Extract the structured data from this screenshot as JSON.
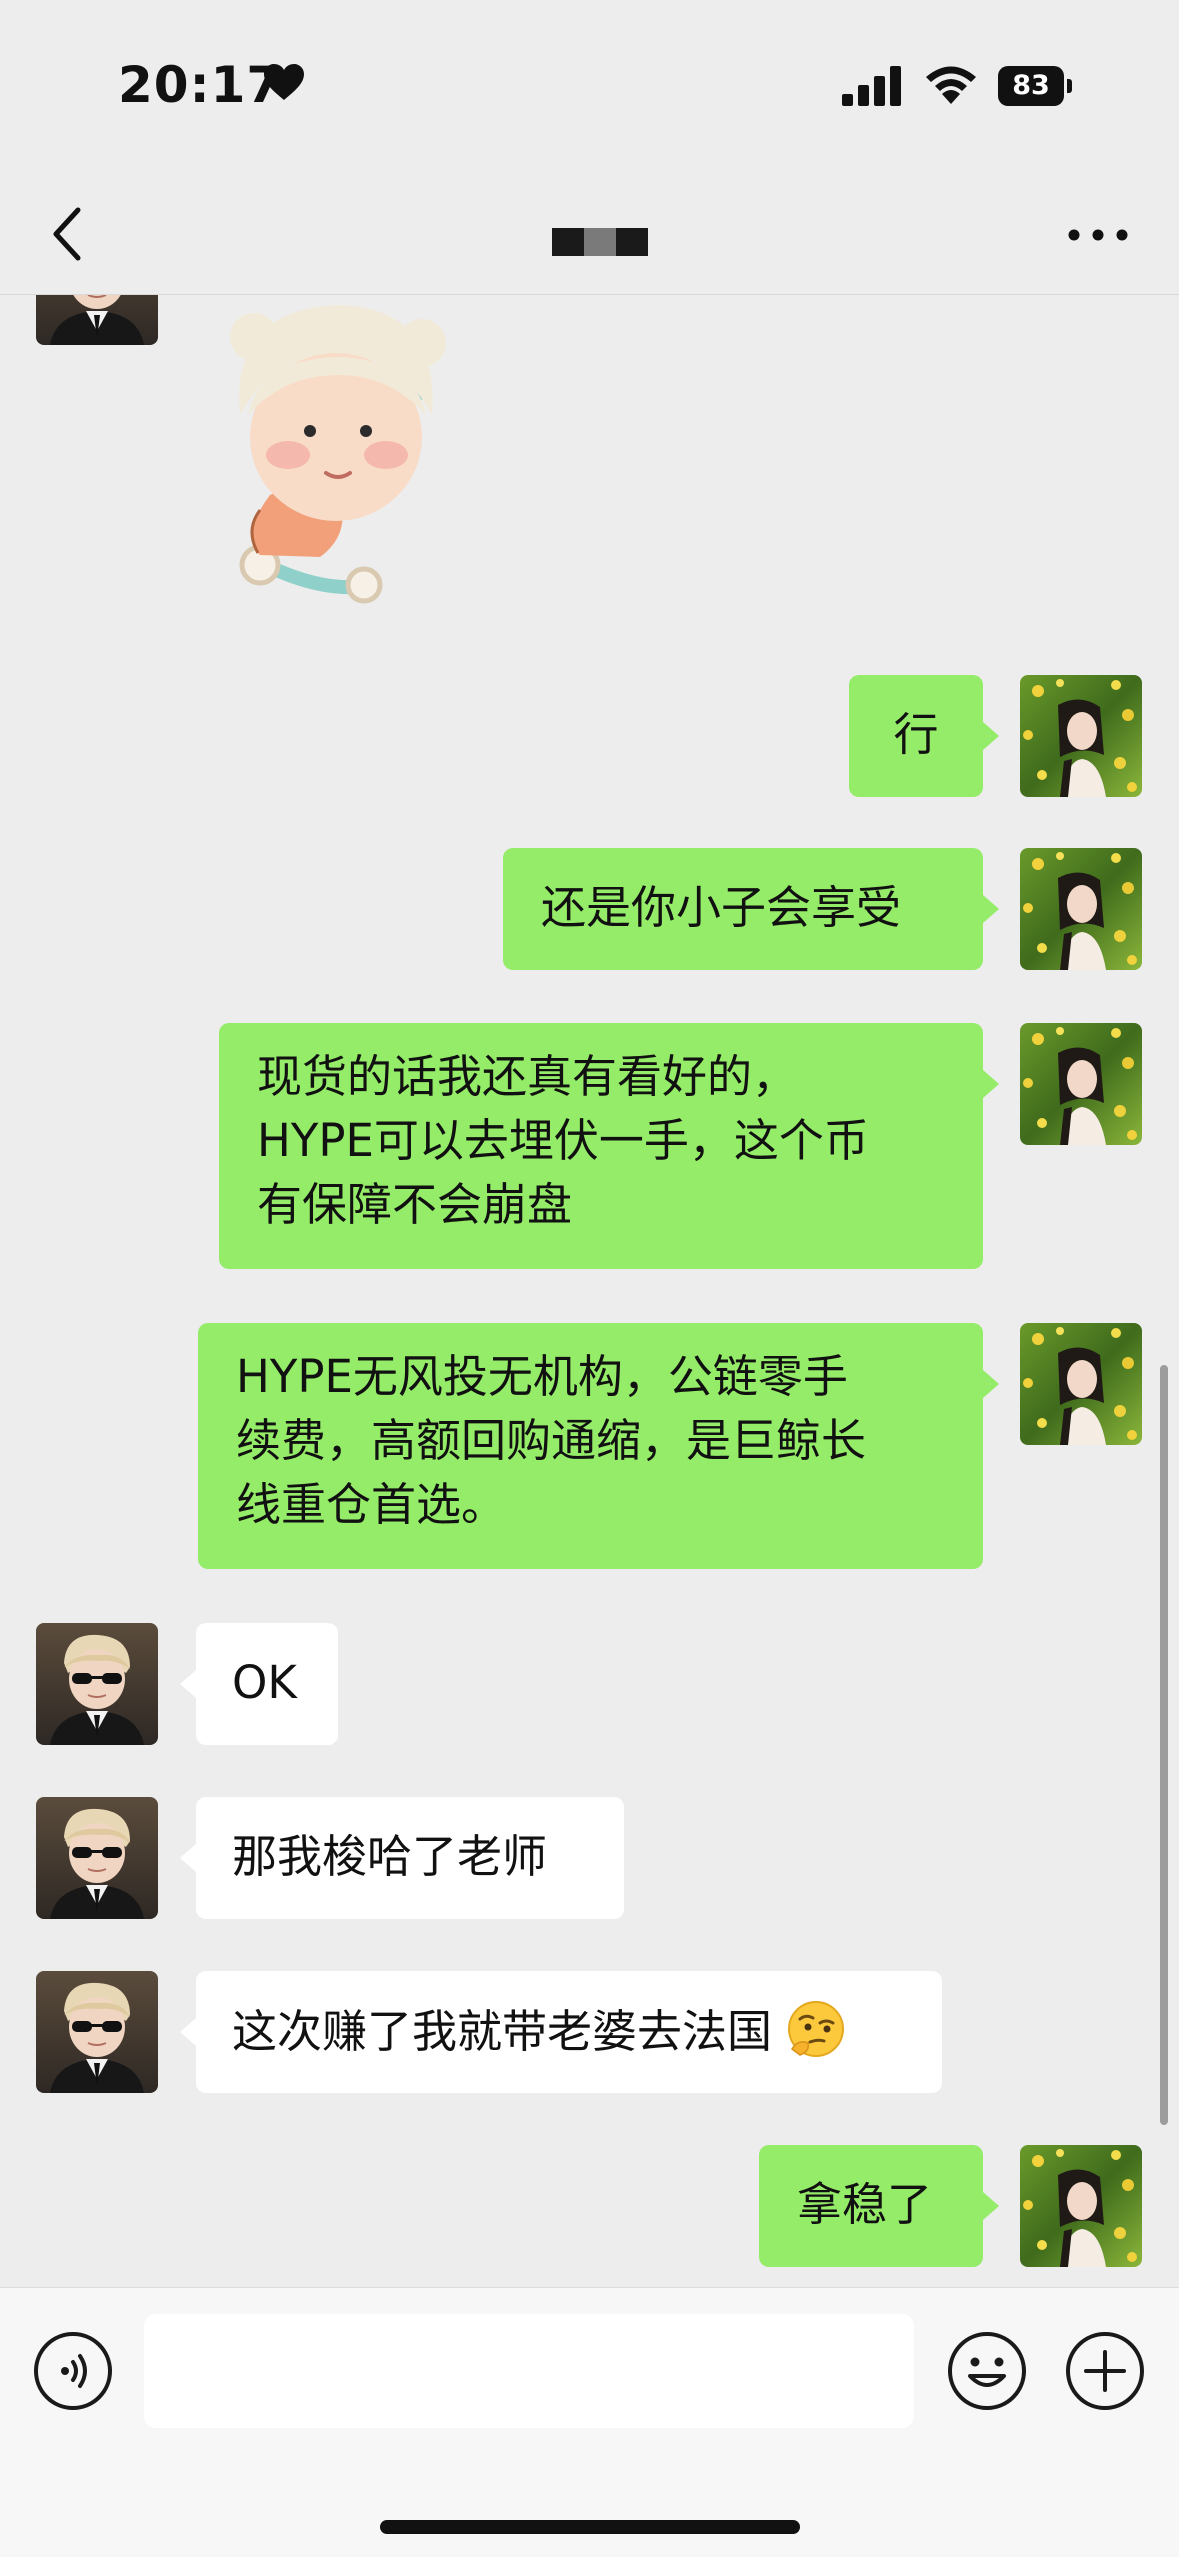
{
  "status_bar": {
    "time": "20:17",
    "battery": "83",
    "icons": [
      "heart-icon",
      "signal-icon",
      "wifi-icon",
      "battery-icon"
    ]
  },
  "nav": {
    "title_redacted": true,
    "icons": [
      "chevron-left-icon",
      "more-dots-icon"
    ]
  },
  "messages": [
    {
      "side": "in",
      "kind": "sticker",
      "avatar": "sunglasses-boy-avatar",
      "sticker": "baby-bear-hat-scooter-sticker"
    },
    {
      "side": "out",
      "kind": "text",
      "text": "行"
    },
    {
      "side": "out",
      "kind": "text",
      "text": "还是你小子会享受"
    },
    {
      "side": "out",
      "kind": "text",
      "lines": [
        "现货的话我还真有看好的，",
        "HYPE可以去埋伏一手，这个币",
        "有保障不会崩盘"
      ]
    },
    {
      "side": "out",
      "kind": "text",
      "lines": [
        "HYPE无风投无机构，公链零手",
        "续费，高额回购通缩，是巨鲸长",
        "线重仓首选。"
      ]
    },
    {
      "side": "in",
      "kind": "text",
      "text": "OK"
    },
    {
      "side": "in",
      "kind": "text",
      "text": "那我梭哈了老师"
    },
    {
      "side": "in",
      "kind": "text",
      "text": "这次赚了我就带老婆去法国",
      "emoji": "thinking-face-icon"
    },
    {
      "side": "out",
      "kind": "text",
      "text": "拿稳了"
    }
  ],
  "input_bar": {
    "placeholder": "",
    "icons": [
      "voice-icon",
      "emoji-icon",
      "plus-icon"
    ]
  },
  "colors": {
    "background": "#ededed",
    "outgoing_bubble": "#95ec69",
    "incoming_bubble": "#ffffff",
    "input_bar": "#f7f7f7"
  }
}
